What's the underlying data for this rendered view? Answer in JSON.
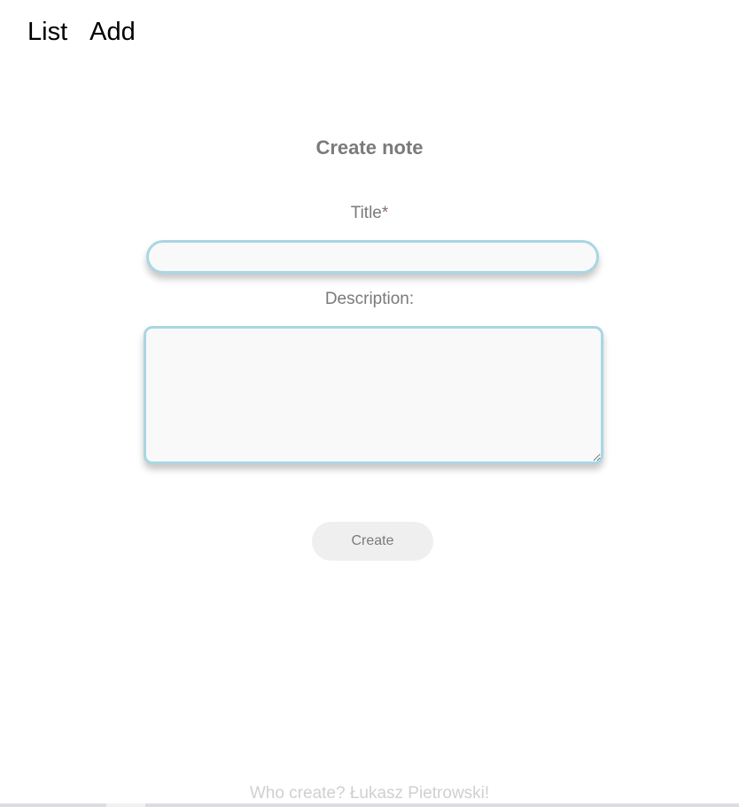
{
  "nav": {
    "items": [
      {
        "label": "List"
      },
      {
        "label": "Add"
      }
    ]
  },
  "form": {
    "heading": "Create note",
    "title_label": "Title",
    "required_marker": "*",
    "title_value": "",
    "description_label": "Description:",
    "description_value": "",
    "submit_label": "Create"
  },
  "footer": {
    "text": "Who create? Łukasz Pietrowski!"
  },
  "colors": {
    "input_border": "#a9d6e3",
    "input_background": "#f9f9f9",
    "text_muted": "#7a7a7a",
    "button_background": "#efefef"
  }
}
